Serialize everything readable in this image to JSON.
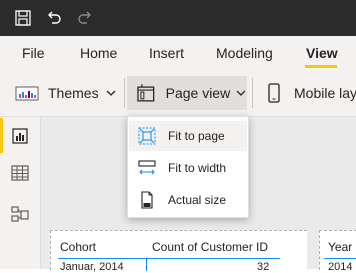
{
  "titlebar": {
    "icons": [
      "save-icon",
      "undo-icon",
      "redo-icon"
    ]
  },
  "tabs": [
    {
      "label": "File"
    },
    {
      "label": "Home"
    },
    {
      "label": "Insert"
    },
    {
      "label": "Modeling"
    },
    {
      "label": "View",
      "active": true
    }
  ],
  "ribbon": {
    "themes_label": "Themes",
    "page_view_label": "Page view",
    "mobile_label": "Mobile lay"
  },
  "page_view_menu": {
    "items": [
      {
        "label": "Fit to page",
        "icon": "fit-to-page-icon",
        "highlighted": true
      },
      {
        "label": "Fit to width",
        "icon": "fit-to-width-icon"
      },
      {
        "label": "Actual size",
        "icon": "actual-size-icon"
      }
    ]
  },
  "leftnav": {
    "items": [
      "report-view-icon",
      "data-view-icon",
      "model-view-icon"
    ],
    "active": "report-view-icon"
  },
  "table": {
    "columns": [
      "Cohort",
      "Count of Customer ID"
    ],
    "rows": [
      {
        "cohort": "Januar, 2014",
        "count": "32"
      }
    ]
  },
  "table2": {
    "columns": [
      "Year"
    ],
    "rows": [
      {
        "year": "2014"
      }
    ]
  },
  "colors": {
    "accent": "#f2c811",
    "titlebar": "#2b2b2b",
    "ribbon_bg": "#f3f2f1",
    "table_header_line": "#118dff"
  }
}
